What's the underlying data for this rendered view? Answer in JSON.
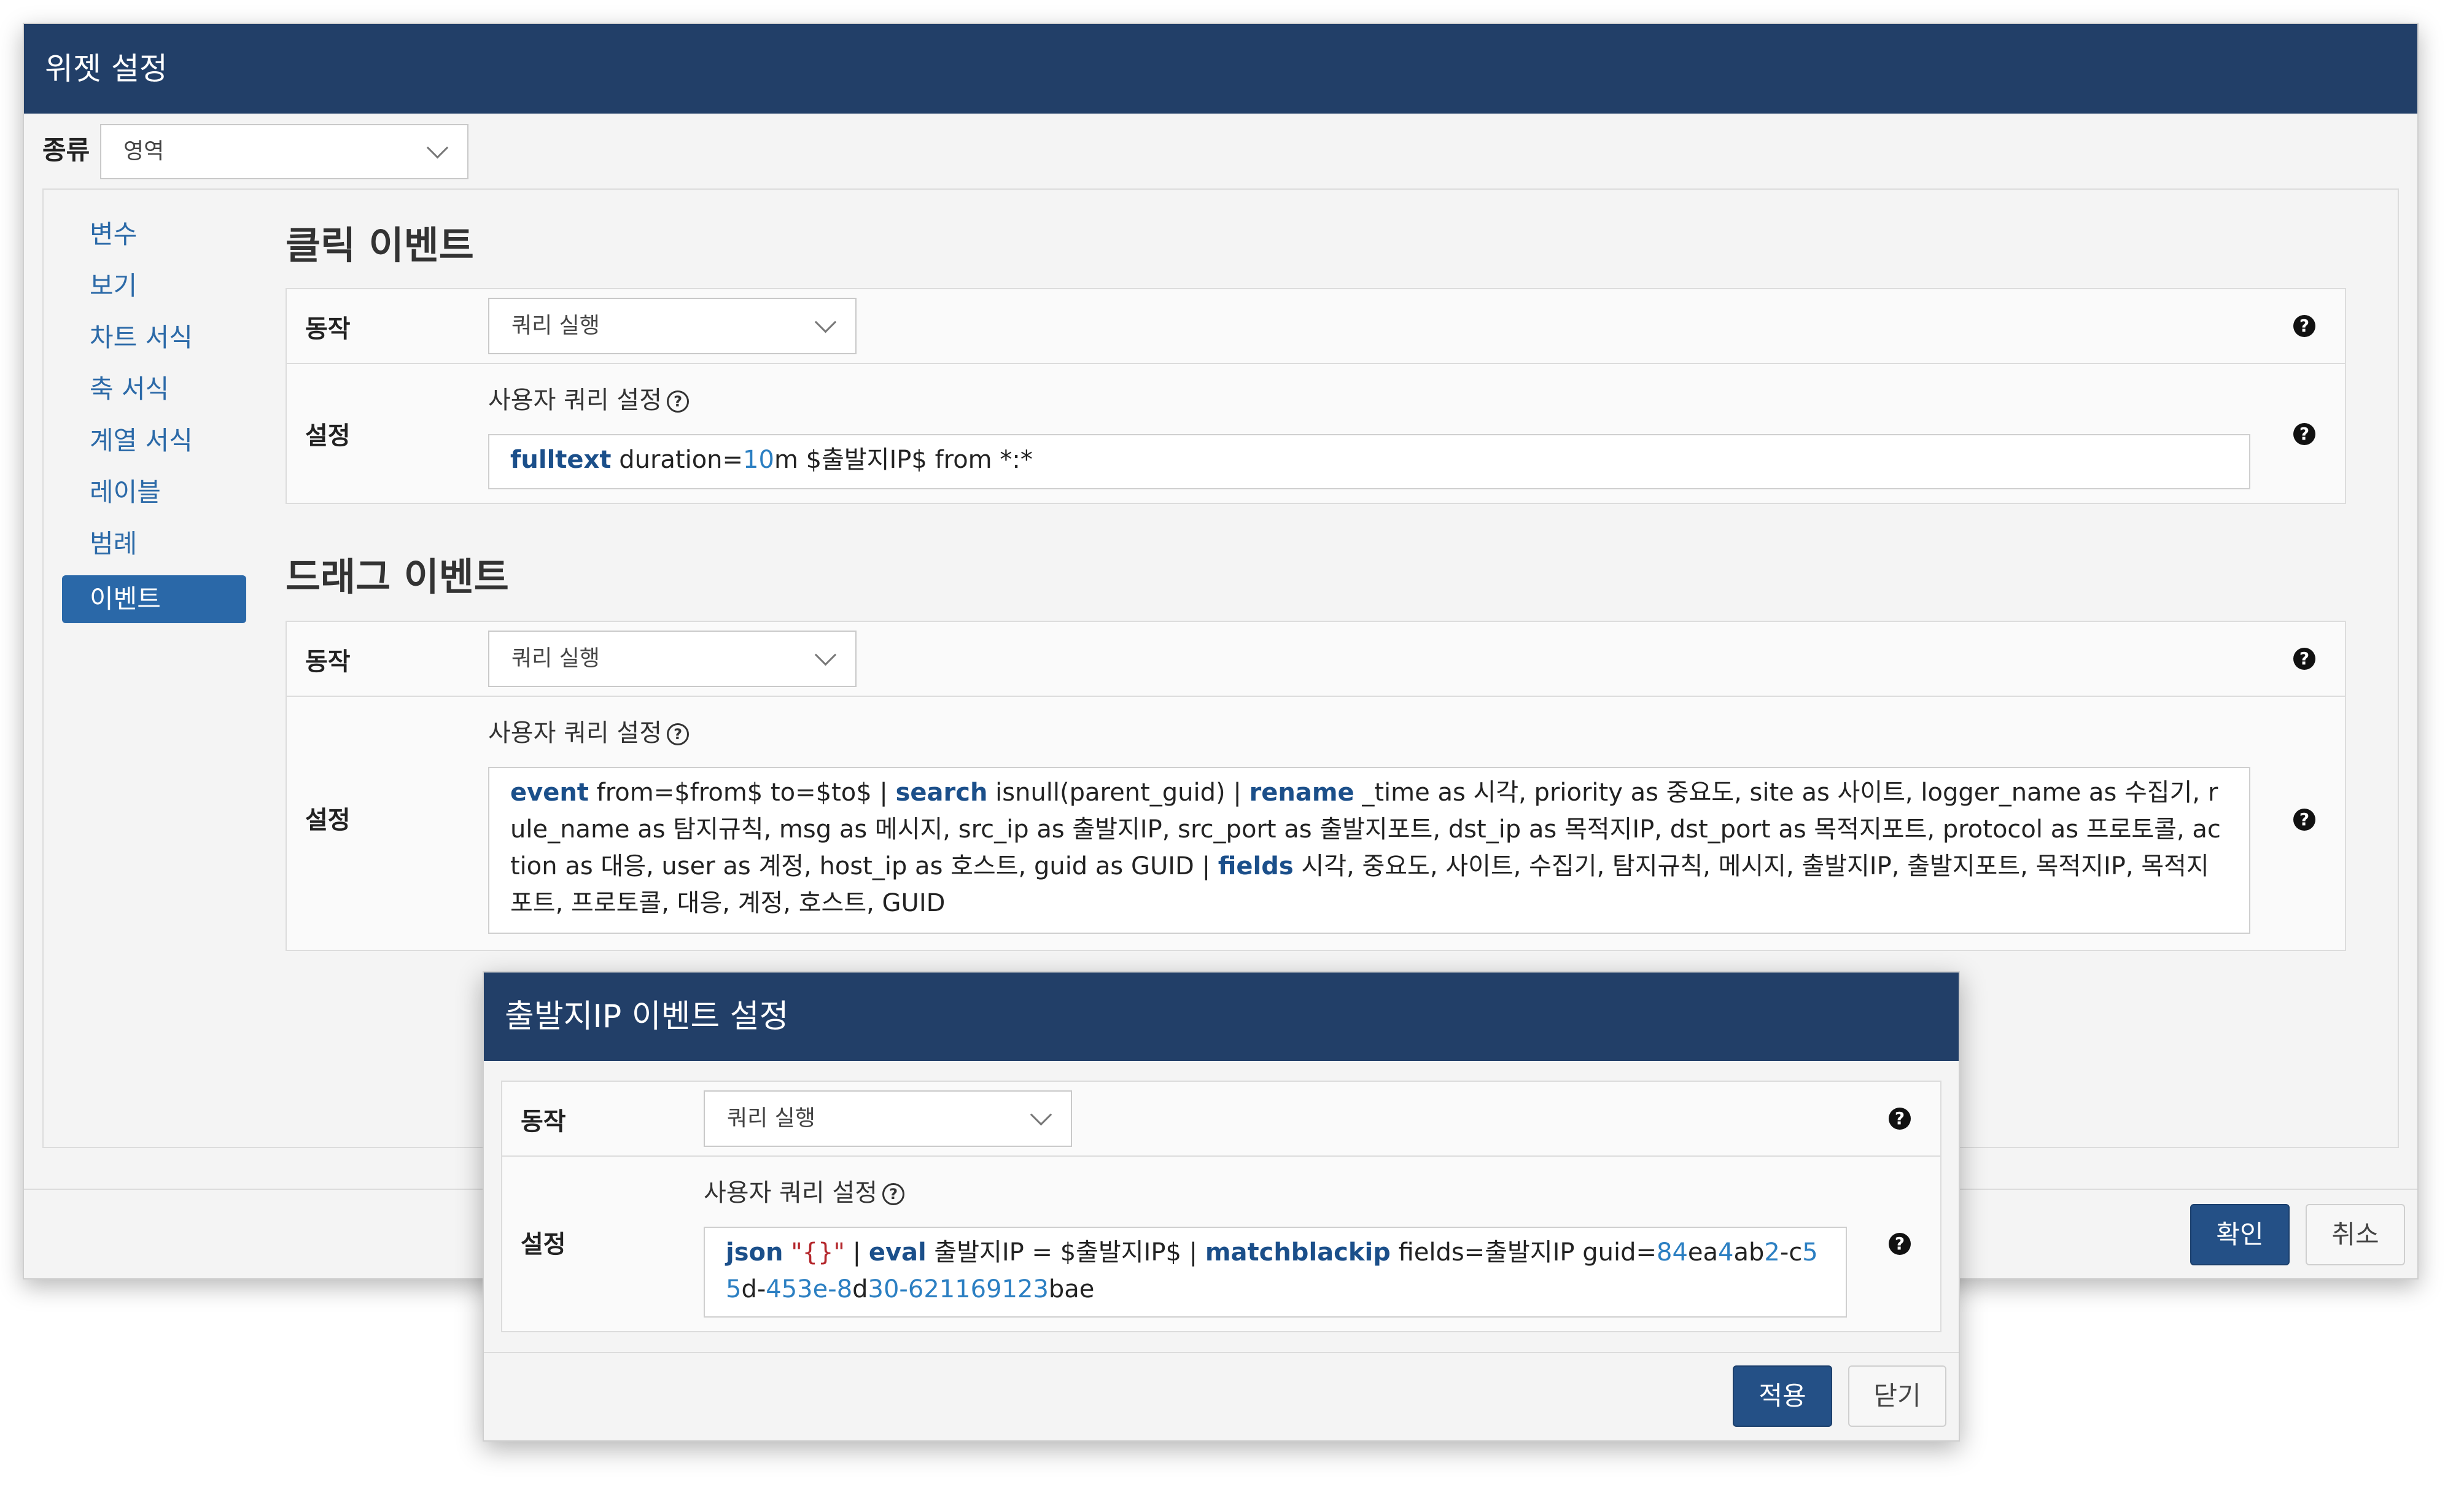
{
  "dialog": {
    "title": "위젯 설정",
    "kind_label": "종류",
    "kind_value": "영역",
    "confirm": "확인",
    "cancel": "취소"
  },
  "nav": {
    "items": [
      {
        "label": "변수"
      },
      {
        "label": "보기"
      },
      {
        "label": "차트 서식"
      },
      {
        "label": "축 서식"
      },
      {
        "label": "계열 서식"
      },
      {
        "label": "레이블"
      },
      {
        "label": "범례"
      },
      {
        "label": "이벤트",
        "active": true
      }
    ]
  },
  "click_event": {
    "title": "클릭 이벤트",
    "action_label": "동작",
    "action_value": "쿼리 실행",
    "settings_label": "설정",
    "user_query_label": "사용자 쿼리 설정",
    "query": {
      "p1": "fulltext",
      "p2": " duration=",
      "p3": "10",
      "p4": "m $출발지IP$ from *:*"
    }
  },
  "drag_event": {
    "title": "드래그 이벤트",
    "action_label": "동작",
    "action_value": "쿼리 실행",
    "settings_label": "설정",
    "user_query_label": "사용자 쿼리 설정",
    "query": {
      "p1": "event",
      "p2": " from=$from$ to=$to$ | ",
      "p3": "search",
      "p4": " isnull(parent_guid) | ",
      "p5": "rename",
      "p6": " _time as 시각, priority as 중요도, site as 사이트, logger_name as 수집기, rule_name as 탐지규칙, msg as 메시지, src_ip as 출발지IP, src_port as 출발지포트, dst_ip as 목적지IP, dst_port as 목적지포트, protocol as 프로토콜, action as 대응, user as 계정, host_ip as 호스트, guid as GUID | ",
      "p7": "fields",
      "p8": " 시각, 중요도, 사이트, 수집기, 탐지규칙, 메시지, 출발지IP, 출발지포트, 목적지IP, 목적지포트, 프로토콜, 대응, 계정, 호스트, GUID"
    }
  },
  "sub_dialog": {
    "title": "출발지IP 이벤트 설정",
    "action_label": "동작",
    "action_value": "쿼리 실행",
    "settings_label": "설정",
    "user_query_label": "사용자 쿼리 설정",
    "query": {
      "p1": "json",
      "p2": " ",
      "p3": "\"{}\"",
      "p4": " | ",
      "p5": "eval",
      "p6": " 출발지IP = $출발지IP$ |  ",
      "p7": "matchblackip",
      "p8": " fields=출발지IP guid=",
      "p9": "84",
      "p10": "ea",
      "p11": "4",
      "p12": "ab",
      "p13": "2",
      "p14": "-c",
      "p15": "55",
      "p16": "d-",
      "p17": "453",
      "p18": "e-",
      "p19": "8",
      "p20": "d",
      "p21": "30-621169123",
      "p22": "bae"
    },
    "apply": "적용",
    "close": "닫기"
  },
  "icons": {
    "help": "question-circle-icon",
    "dropdown": "chevron-down-icon"
  },
  "colors": {
    "header_bg": "#223f68",
    "accent": "#2a68a8",
    "keyword": "#1b4f8a",
    "number": "#2b7fc2",
    "string": "#b4262b"
  }
}
